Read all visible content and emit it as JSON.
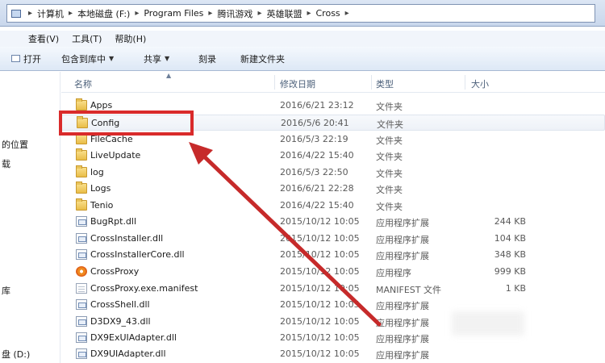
{
  "breadcrumb": {
    "items": [
      "计算机",
      "本地磁盘 (F:)",
      "Program Files",
      "腾讯游戏",
      "英雄联盟",
      "Cross"
    ],
    "separator": "▸"
  },
  "menubar": {
    "items": [
      "查看(V)",
      "工具(T)",
      "帮助(H)"
    ]
  },
  "toolbar": {
    "open_label": "打开",
    "include_label": "包含到库中",
    "share_label": "共享",
    "burn_label": "刻录",
    "new_folder_label": "新建文件夹"
  },
  "navpane": {
    "fragments": [
      "的位置",
      "载",
      "库",
      "盘 (D:)"
    ]
  },
  "columns": {
    "name": "名称",
    "modified": "修改日期",
    "type": "类型",
    "size": "大小"
  },
  "files": [
    {
      "name": "Apps",
      "date": "2016/6/21 23:12",
      "type": "文件夹",
      "size": "",
      "icon": "folder-icon"
    },
    {
      "name": "Config",
      "date": "2016/5/6 20:41",
      "type": "文件夹",
      "size": "",
      "icon": "folder-icon"
    },
    {
      "name": "FileCache",
      "date": "2016/5/3 22:19",
      "type": "文件夹",
      "size": "",
      "icon": "folder-icon"
    },
    {
      "name": "LiveUpdate",
      "date": "2016/4/22 15:40",
      "type": "文件夹",
      "size": "",
      "icon": "folder-icon"
    },
    {
      "name": "log",
      "date": "2016/5/3 22:50",
      "type": "文件夹",
      "size": "",
      "icon": "folder-icon"
    },
    {
      "name": "Logs",
      "date": "2016/6/21 22:28",
      "type": "文件夹",
      "size": "",
      "icon": "folder-icon"
    },
    {
      "name": "Tenio",
      "date": "2016/4/22 15:40",
      "type": "文件夹",
      "size": "",
      "icon": "folder-icon"
    },
    {
      "name": "BugRpt.dll",
      "date": "2015/10/12 10:05",
      "type": "应用程序扩展",
      "size": "244 KB",
      "icon": "dll-icon"
    },
    {
      "name": "CrossInstaller.dll",
      "date": "2015/10/12 10:05",
      "type": "应用程序扩展",
      "size": "104 KB",
      "icon": "dll-icon"
    },
    {
      "name": "CrossInstallerCore.dll",
      "date": "2015/10/12 10:05",
      "type": "应用程序扩展",
      "size": "348 KB",
      "icon": "dll-icon"
    },
    {
      "name": "CrossProxy",
      "date": "2015/10/12 10:05",
      "type": "应用程序",
      "size": "999 KB",
      "icon": "app-icon"
    },
    {
      "name": "CrossProxy.exe.manifest",
      "date": "2015/10/12 10:05",
      "type": "MANIFEST 文件",
      "size": "1 KB",
      "icon": "document-icon"
    },
    {
      "name": "CrossShell.dll",
      "date": "2015/10/12 10:05",
      "type": "应用程序扩展",
      "size": "",
      "icon": "dll-icon"
    },
    {
      "name": "D3DX9_43.dll",
      "date": "2015/10/12 10:05",
      "type": "应用程序扩展",
      "size": "",
      "icon": "dll-icon"
    },
    {
      "name": "DX9ExUIAdapter.dll",
      "date": "2015/10/12 10:05",
      "type": "应用程序扩展",
      "size": "",
      "icon": "dll-icon"
    },
    {
      "name": "DX9UIAdapter.dll",
      "date": "2015/10/12 10:05",
      "type": "应用程序扩展",
      "size": "",
      "icon": "dll-icon"
    }
  ],
  "selected_index": 1,
  "annotation": {
    "highlight_color": "#d92b2b",
    "arrow_color": "#c62a2a"
  }
}
